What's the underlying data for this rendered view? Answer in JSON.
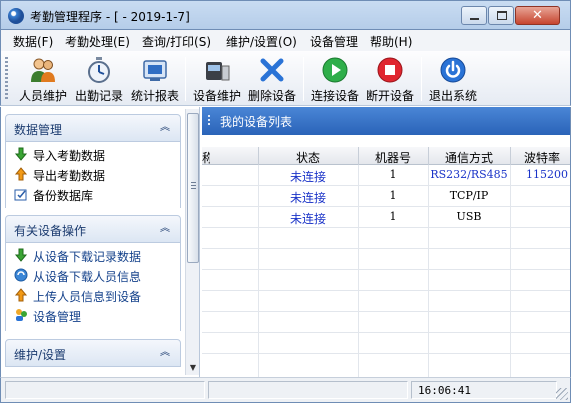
{
  "window": {
    "title": "考勤管理程序 - [ - 2019-1-7]",
    "minimize_symbol": "",
    "maximize_symbol": "",
    "close_symbol": "✕"
  },
  "menu": [
    {
      "label": "数据(F)"
    },
    {
      "label": "考勤处理(E)"
    },
    {
      "label": "查询/打印(S)"
    },
    {
      "label": "维护/设置(O)"
    },
    {
      "label": "设备管理"
    },
    {
      "label": "帮助(H)"
    }
  ],
  "toolbar": [
    {
      "label": "人员维护",
      "icon": "people-icon"
    },
    {
      "label": "出勤记录",
      "icon": "stopwatch-icon"
    },
    {
      "label": "统计报表",
      "icon": "report-icon"
    },
    {
      "label": "设备维护",
      "icon": "device-icon"
    },
    {
      "label": "删除设备",
      "icon": "delete-x-icon"
    },
    {
      "label": "连接设备",
      "icon": "connect-play-icon"
    },
    {
      "label": "断开设备",
      "icon": "disconnect-stop-icon"
    },
    {
      "label": "退出系统",
      "icon": "power-icon"
    }
  ],
  "sidebar": {
    "sections": [
      {
        "title": "数据管理",
        "collapse_glyph": "︽",
        "items": [
          {
            "label": "导入考勤数据",
            "icon": "arrow-down-green-icon"
          },
          {
            "label": "导出考勤数据",
            "icon": "arrow-up-orange-icon"
          },
          {
            "label": "备份数据库",
            "icon": "backup-icon"
          }
        ]
      },
      {
        "title": "有关设备操作",
        "collapse_glyph": "︽",
        "items": [
          {
            "label": "从设备下载记录数据",
            "icon": "arrow-down-green-icon"
          },
          {
            "label": "从设备下载人员信息",
            "icon": "sync-icon"
          },
          {
            "label": "上传人员信息到设备",
            "icon": "arrow-up-orange-icon"
          },
          {
            "label": "设备管理",
            "icon": "users-icon"
          }
        ]
      },
      {
        "title": "维护/设置",
        "collapse_glyph": "︽",
        "items": []
      }
    ],
    "scroll_down_glyph": "▼"
  },
  "device_panel": {
    "title": "我的设备列表",
    "columns": [
      "称",
      "状态",
      "机器号",
      "通信方式",
      "波特率"
    ],
    "rows": [
      {
        "name": "",
        "status": "未连接",
        "machine_no": "1",
        "comm": "RS232/RS485",
        "baud": "115200"
      },
      {
        "name": "",
        "status": "未连接",
        "machine_no": "1",
        "comm": "TCP/IP",
        "baud": ""
      },
      {
        "name": "",
        "status": "未连接",
        "machine_no": "1",
        "comm": "USB",
        "baud": ""
      }
    ]
  },
  "statusbar": {
    "left_text": "",
    "middle_text": "",
    "time": "16:06:41"
  },
  "colors": {
    "panel_header": "#2f6dc3",
    "status_text": "#1a33c8",
    "accent": "#15428b"
  }
}
